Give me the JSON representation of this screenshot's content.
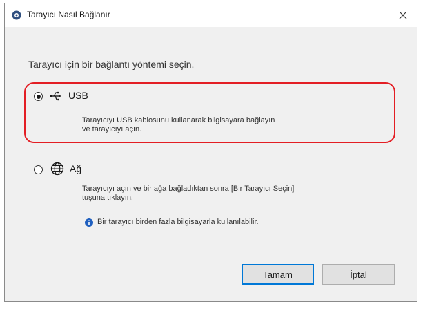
{
  "window": {
    "title": "Tarayıcı Nasıl Bağlanır",
    "close_glyph": "✕"
  },
  "instruction": "Tarayıcı için bir bağlantı yöntemi seçin.",
  "options": [
    {
      "label": "USB",
      "selected": true,
      "icon": "usb-icon",
      "description_line1": "Tarayıcıyı USB kablosunu kullanarak bilgisayara bağlayın",
      "description_line2": "ve tarayıcıyı açın."
    },
    {
      "label": "Ağ",
      "selected": false,
      "icon": "globe-icon",
      "description_line1": "Tarayıcıyı açın ve bir ağa bağladıktan sonra [Bir Tarayıcı Seçin]",
      "description_line2": "tuşuna tıklayın."
    }
  ],
  "info_note": "Bir tarayıcı birden fazla bilgisayarla kullanılabilir.",
  "buttons": {
    "ok": "Tamam",
    "cancel": "İptal"
  },
  "colors": {
    "highlight": "#e31e24",
    "accent": "#0078d7",
    "info": "#1f5fbf"
  }
}
